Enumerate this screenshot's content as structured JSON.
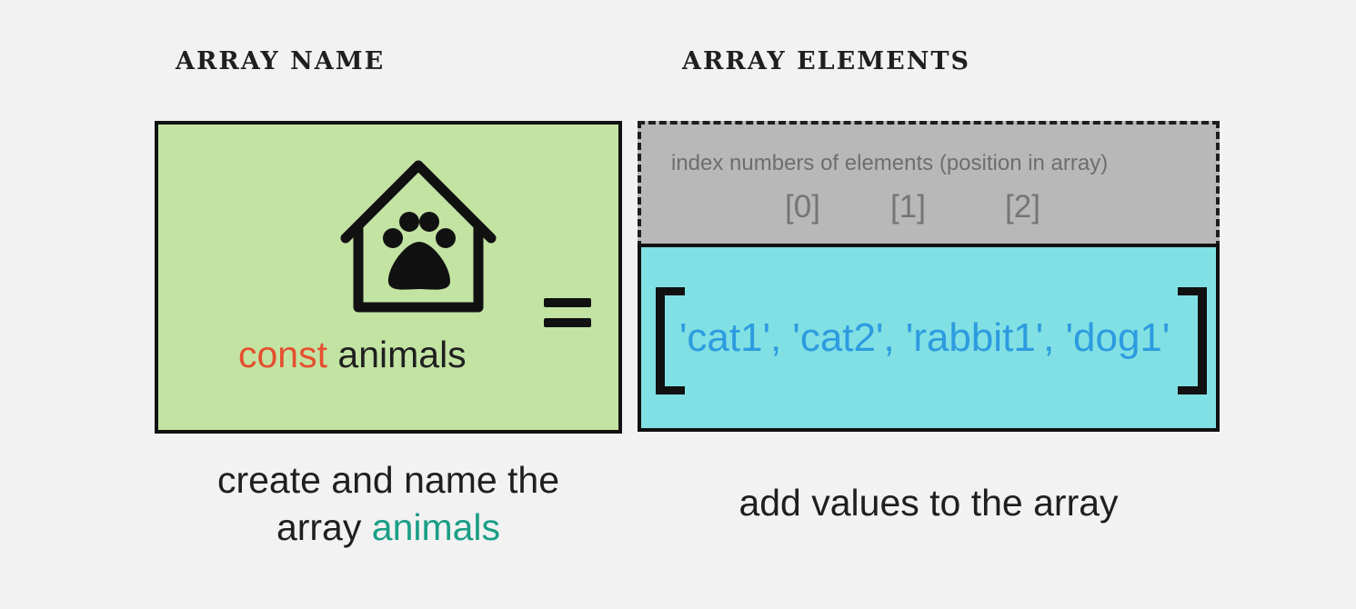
{
  "headings": {
    "array_name": "ARRAY NAME",
    "array_elements": "ARRAY ELEMENTS"
  },
  "name_box": {
    "icon": "dog-house-paw-icon",
    "keyword": "const",
    "variable": "animals",
    "colors": {
      "background": "#c3e3a3",
      "keyword": "#e5502e"
    }
  },
  "operator": "=",
  "index_box": {
    "caption": "index numbers of elements (position in array)",
    "indices": [
      "[0]",
      "[1]",
      "[2]"
    ],
    "colors": {
      "background": "#b8b8b8"
    }
  },
  "values_box": {
    "values_text": "'cat1', 'cat2', 'rabbit1', 'dog1'",
    "colors": {
      "background": "#81e0e3",
      "text": "#2d9be0"
    }
  },
  "captions": {
    "name_line1": "create and name the",
    "name_line2_prefix": "array",
    "name_highlight": "animals",
    "elements": "add values to the array",
    "highlight_color": "#1a9e86"
  }
}
